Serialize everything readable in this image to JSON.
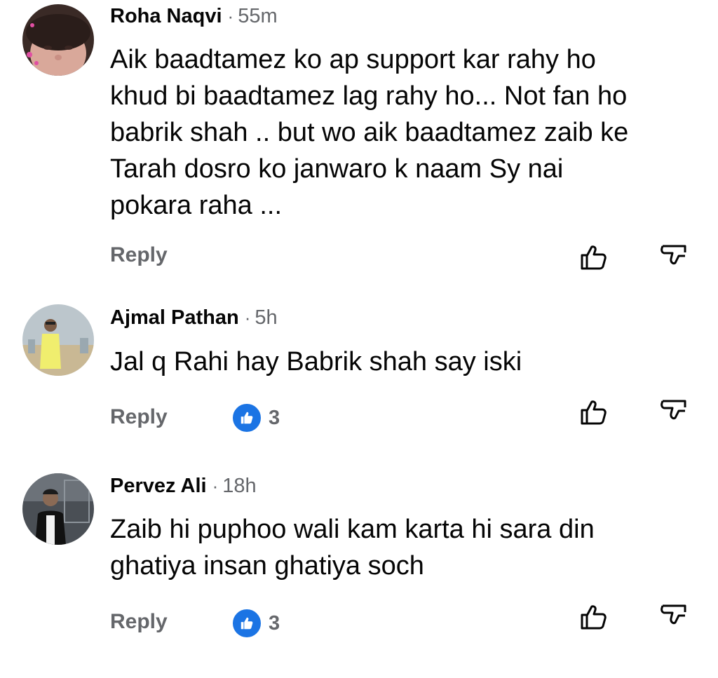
{
  "comments": [
    {
      "author": "Roha Naqvi",
      "time": "55m",
      "text": "Aik baadtamez ko ap support kar rahy ho\nkhud bi baadtamez lag rahy ho... Not fan ho\nbabrik shah .. but wo aik baadtamez zaib ke\nTarah dosro ko janwaro k naam Sy nai\npokara raha ...",
      "reply_label": "Reply",
      "likes": null
    },
    {
      "author": "Ajmal Pathan",
      "time": "5h",
      "text": "Jal q Rahi hay Babrik shah say iski",
      "reply_label": "Reply",
      "likes": "3"
    },
    {
      "author": "Pervez Ali",
      "time": "18h",
      "text": "Zaib hi puphoo wali kam karta hi sara din\nghatiya insan ghatiya soch",
      "reply_label": "Reply",
      "likes": "3"
    }
  ],
  "separator": "·",
  "icons": {
    "upvote": "thumbs-up-outline-icon",
    "downvote": "thumbs-down-outline-icon",
    "reaction": "like-reaction-icon"
  },
  "colors": {
    "reaction_blue": "#1b74e4",
    "secondary_text": "#65676b",
    "primary_text": "#050505"
  }
}
